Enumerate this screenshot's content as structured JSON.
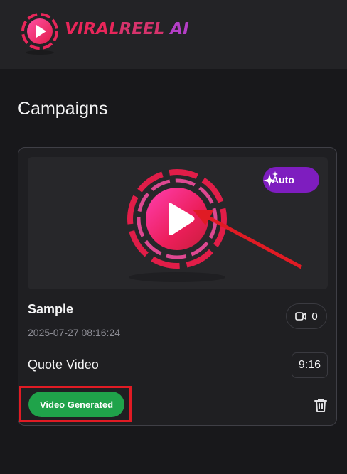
{
  "brand": {
    "part1": "VIRAL",
    "part2": "REEL",
    "part3": " AI",
    "colors": [
      "#e8265a",
      "#b43ec6"
    ]
  },
  "page": {
    "title": "Campaigns"
  },
  "campaign": {
    "badge": "Auto",
    "name": "Sample",
    "date": "2025-07-27 08:16:24",
    "video_count": "0",
    "type": "Quote Video",
    "ratio": "9:16",
    "status": "Video Generated",
    "status_color": "#1fa34a"
  },
  "icons": [
    "logo-play-icon",
    "sparkle-icon",
    "video-camera-icon",
    "trash-icon"
  ]
}
